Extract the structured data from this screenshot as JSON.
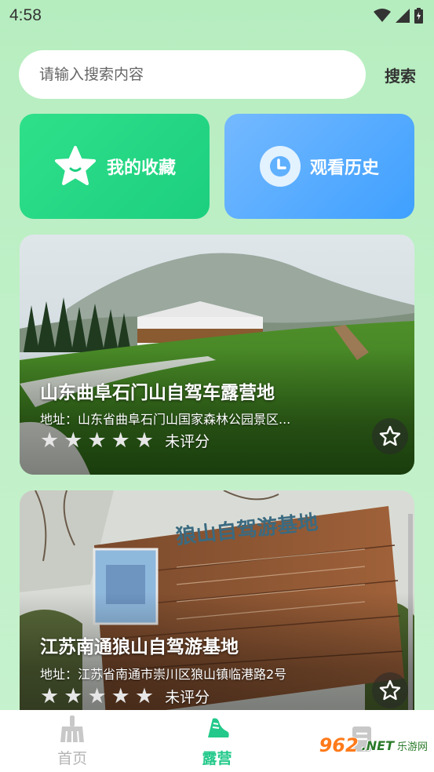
{
  "status_bar": {
    "time": "4:58"
  },
  "search": {
    "placeholder": "请输入搜索内容",
    "button_label": "搜索"
  },
  "tiles": {
    "favorites_label": "我的收藏",
    "history_label": "观看历史"
  },
  "cards": [
    {
      "title": "山东曲阜石门山自驾车露营地",
      "address": "地址：山东省曲阜石门山国家森林公园景区...",
      "rating_text": "未评分",
      "stars": 0
    },
    {
      "title": "江苏南通狼山自驾游基地",
      "address": "地址：江苏省南通市崇川区狼山镇临港路2号",
      "rating_text": "未评分",
      "stars": 0,
      "sign_text": "狼山自驾游基地"
    }
  ],
  "bottom_nav": [
    {
      "label": "首页",
      "icon": "broom-icon",
      "active": false
    },
    {
      "label": "露营",
      "icon": "shoe-icon",
      "active": true
    },
    {
      "label": "",
      "icon": "document-icon",
      "active": false
    }
  ],
  "watermark": {
    "brand": "962",
    "suffix": ".NET",
    "caption": "乐游网"
  },
  "colors": {
    "accent": "#22c98a",
    "fav_tile": "#1ccf7f",
    "history_tile": "#3fa0ff"
  }
}
